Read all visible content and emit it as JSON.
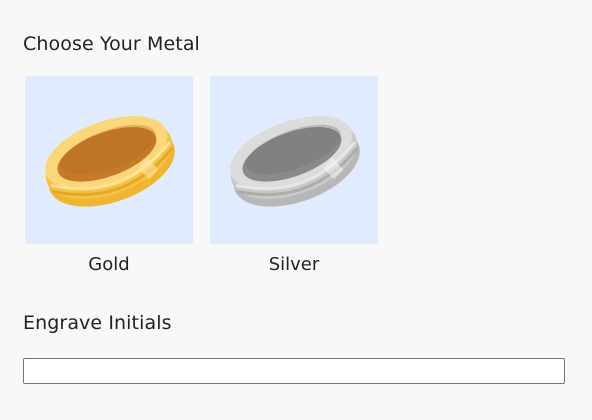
{
  "metal_section": {
    "title": "Choose Your Metal",
    "options": [
      {
        "label": "Gold",
        "icon": "gold-ring-icon",
        "colors": {
          "body": "#f6c244",
          "outer": "#f0b530",
          "inner": "#c57a2a",
          "rim": "#fbd77a",
          "highlight": "#fde9a6"
        }
      },
      {
        "label": "Silver",
        "icon": "silver-ring-icon",
        "colors": {
          "body": "#c9c9c9",
          "outer": "#b7b7b7",
          "inner": "#8a8a8a",
          "rim": "#dcdcdc",
          "highlight": "#ececec"
        }
      }
    ],
    "swatch_background": "#e0ecfd"
  },
  "engrave_section": {
    "title": "Engrave Initials",
    "input_value": "",
    "input_placeholder": ""
  }
}
